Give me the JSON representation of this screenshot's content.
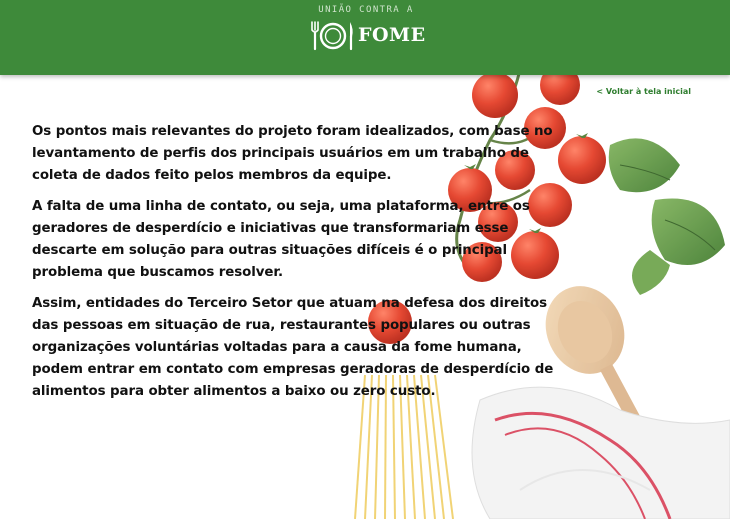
{
  "header": {
    "logo_top_text": "UNIÃO CONTRA A",
    "logo_word": "FOME",
    "logo_icon": "plate-cutlery-icon",
    "background_color": "#3e8a3a"
  },
  "nav": {
    "back_link_label": "< Voltar à tela inicial",
    "link_color": "#2e7d2e"
  },
  "main": {
    "paragraphs": [
      "Os pontos mais relevantes do projeto foram idealizados, com base no levantamento de perfis dos principais usuários em um trabalho de coleta de dados feito pelos membros da equipe.",
      "A falta de uma linha de contato, ou seja, uma plataforma, entre os geradores de desperdício e iniciativas que transformariam esse descarte em solução para outras situações difíceis é o principal problema que buscamos resolver.",
      "Assim, entidades do Terceiro Setor que atuam na defesa dos direitos das pessoas em situação de rua, restaurantes populares ou outras organizações voluntárias voltadas para a causa da fome humana, podem entrar em contato com empresas geradoras de desperdício de alimentos para obter alimentos a baixo ou zero custo."
    ]
  }
}
